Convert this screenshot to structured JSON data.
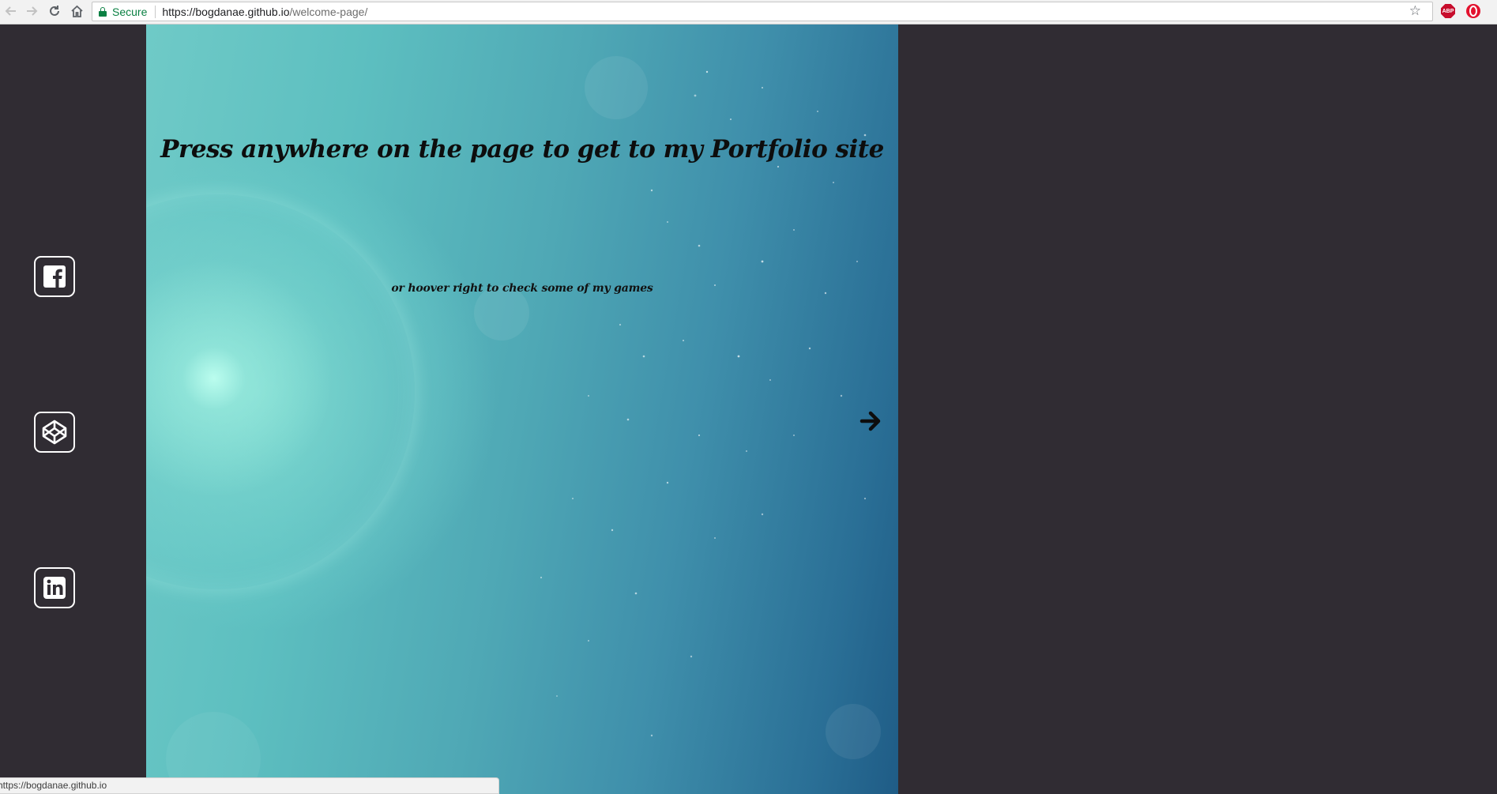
{
  "browser": {
    "secure_label": "Secure",
    "url_host": "https://bogdanae.github.io",
    "url_path": "/welcome-page/",
    "icons": [
      "back-arrow-icon",
      "forward-arrow-icon",
      "reload-icon",
      "home-icon",
      "lock-icon",
      "star-icon",
      "adblock-plus-icon",
      "opera-icon"
    ],
    "extension_abp_label": "ABP"
  },
  "sidebar": {
    "links": [
      {
        "name": "facebook",
        "icon": "facebook-icon"
      },
      {
        "name": "codepen",
        "icon": "codepen-icon"
      },
      {
        "name": "linkedin",
        "icon": "linkedin-icon"
      }
    ]
  },
  "hero": {
    "title": "Press anywhere on the page to get to my Portfolio site",
    "subtitle": "or hoover right to check some of my games",
    "arrow_icon": "arrow-right-icon"
  },
  "status_bar": {
    "text": "https://bogdanae.github.io"
  },
  "colors": {
    "page_background": "#302c33",
    "secure_green": "#0b8043",
    "hero_teal": "#5dbfc0",
    "hero_blue": "#1f5c86"
  }
}
